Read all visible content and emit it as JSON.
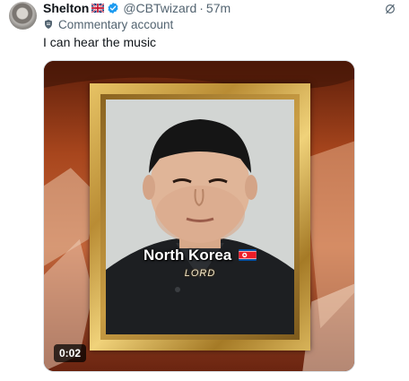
{
  "post": {
    "author_name": "Shelton",
    "author_flag_icon": "uk-flag-icon",
    "verified_icon": "verified-badge-icon",
    "handle": "@CBTwizard",
    "separator": "·",
    "timestamp": "57m",
    "commentary_label": "Commentary account",
    "text": "I can hear the music"
  },
  "video": {
    "caption": "North Korea",
    "caption_flag_icon": "north-korea-flag-icon",
    "watermark": "LORD",
    "timer": "0:02"
  },
  "colors": {
    "text_primary": "#0f1419",
    "text_secondary": "#536471",
    "verified_blue": "#1d9bf0",
    "frame_gold": "#d8b45a"
  }
}
